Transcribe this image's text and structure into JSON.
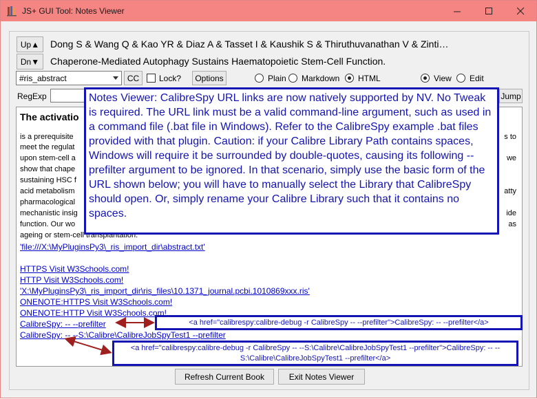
{
  "window": {
    "title": "JS+ GUI Tool:  Notes Viewer",
    "minimize_label": "–",
    "maximize_label": "☐",
    "close_label": "✕"
  },
  "header": {
    "up_label": "Up▲",
    "dn_label": "Dn▼",
    "authors": "Dong S & Wang Q & Kao YR & Diaz A & Tasset I & Kaushik S & Thiruthuvanathan V & Zinti…",
    "article_title": "Chaperone-Mediated Autophagy Sustains Haematopoietic Stem-Cell Function."
  },
  "toolbar": {
    "combo_value": "#ris_abstract",
    "cc_label": "CC",
    "lock_label": "Lock?",
    "options_label": "Options",
    "mode_options": [
      "Plain",
      "Markdown",
      "HTML"
    ],
    "mode_selected": "HTML",
    "edit_options": [
      "View",
      "Edit"
    ],
    "edit_selected": "View"
  },
  "search": {
    "regexp_label": "RegExp",
    "jump_label": "Jump"
  },
  "content": {
    "title": "The activatio",
    "left_lines": [
      "is a prerequisite",
      "meet the regulat",
      "upon stem-cell a",
      "show that chape",
      "sustaining HSC f",
      "acid metabolism",
      "pharmacological",
      "mechanistic insig",
      "function. Our wo",
      "ageing or stem-cell transplantation."
    ],
    "right_lines": [
      "s to",
      "",
      "we",
      "",
      "",
      "atty",
      "",
      "ide",
      "",
      ""
    ],
    "last_right": "as",
    "links": [
      "'file:///X:\\MyPluginsPy3\\_ris_import_dir\\abstract.txt'",
      "HTTPS Visit W3Schools.com!",
      "HTTP Visit W3Schools.com!",
      "'X:\\MyPluginsPy3\\_ris_import_dir\\ris_files\\10.1371_journal.pcbi.1010869xxx.ris'",
      "ONENOTE:HTTPS Visit W3Schools.com!",
      "ONENOTE:HTTP Visit W3Schools.com!",
      "CalibreSpy: -- --prefilter",
      "CalibreSpy: -- --S:\\Calibre\\CalibreJobSpyTest1 --prefilter"
    ]
  },
  "annotations": {
    "main": "Notes Viewer: CalibreSpy URL links are now natively supported by NV.  No Tweak is required.  The URL link must be a valid command-line argument, such as used in a command file (.bat file in Windows).  Refer to the CalibreSpy example .bat files provided with that plugin.  Caution: if your Calibre Library Path contains spaces,  Windows will require it be surrounded by double-quotes, causing its following --prefilter argument to be ignored.  In that scenario, simply use the basic form of the URL shown below; you will have to manually select the Library that CalibreSpy should open.  Or, simply rename your Calibre Library such that it contains no spaces.",
    "code1": "<a href=\"calibrespy:calibre-debug -r CalibreSpy -- --prefilter\">CalibreSpy:  -- --prefilter</a>",
    "code2": "<a href=\"calibrespy:calibre-debug -r CalibreSpy -- --S:\\Calibre\\CalibreJobSpyTest1 --prefilter\">CalibreSpy: -- --S:\\Calibre\\CalibreJobSpyTest1 --prefilter</a>"
  },
  "footer": {
    "refresh_label": "Refresh Current Book",
    "exit_label": "Exit Notes Viewer"
  },
  "colors": {
    "titlebar": "#f58583",
    "annotation": "#1414b4",
    "arrow": "#a02020",
    "link": "#0000cc"
  }
}
